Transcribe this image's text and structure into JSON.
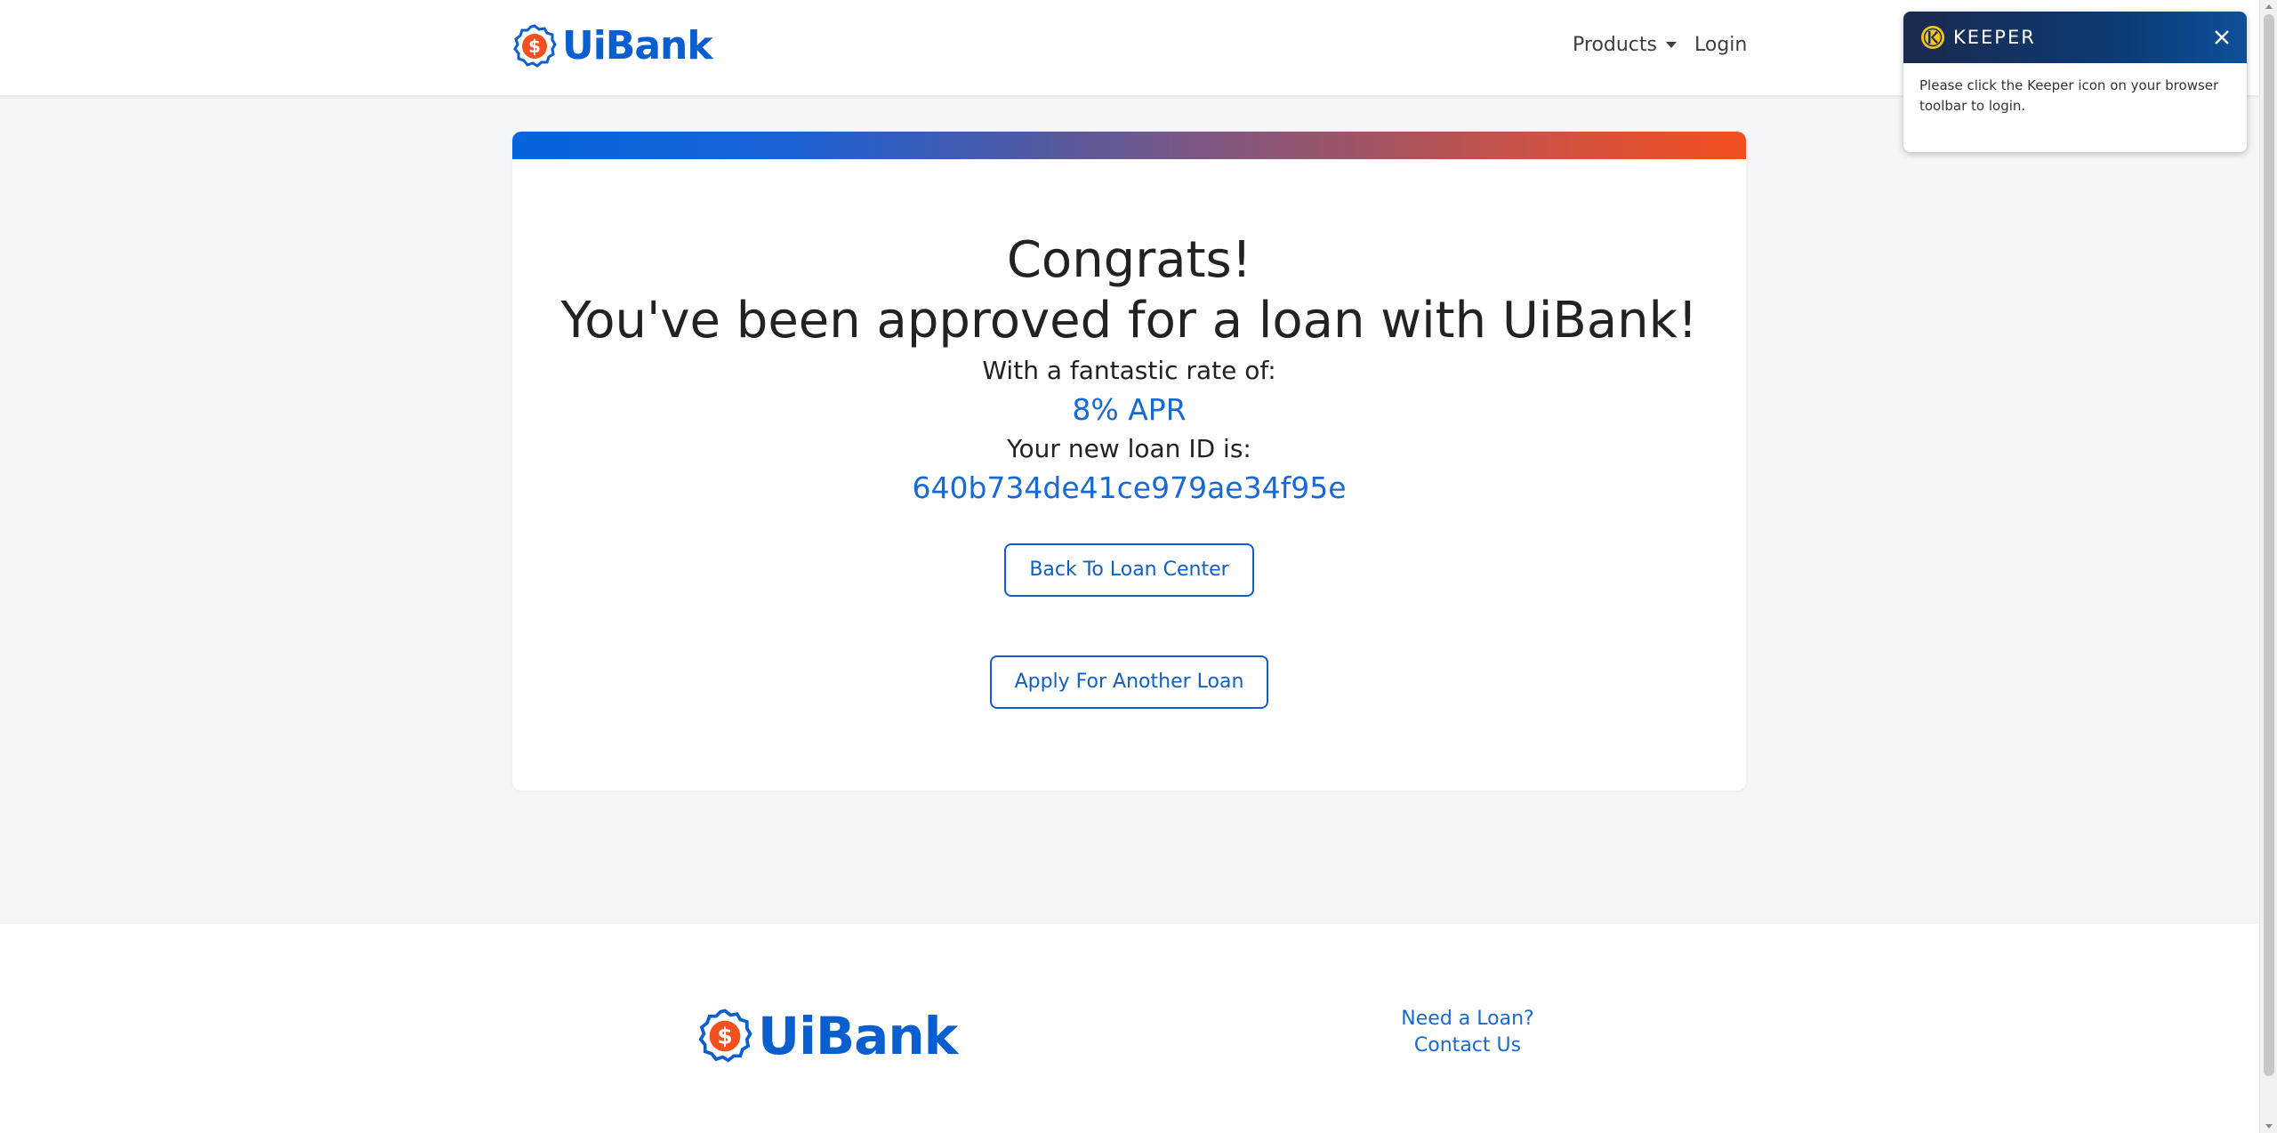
{
  "header": {
    "logo_text": "UiBank",
    "nav": {
      "products_label": "Products",
      "login_label": "Login"
    }
  },
  "card": {
    "congrats": "Congrats!",
    "approved": "You've been approved for a loan with UiBank!",
    "rate_label": "With a fantastic rate of:",
    "rate_value": "8% APR",
    "id_label": "Your new loan ID is:",
    "id_value": "640b734de41ce979ae34f95e",
    "back_button": "Back To Loan Center",
    "apply_button": "Apply For Another Loan"
  },
  "footer": {
    "logo_text": "UiBank",
    "links": {
      "need_loan": "Need a Loan?",
      "contact": "Contact Us"
    }
  },
  "keeper": {
    "title": "KEEPER",
    "message": "Please click the Keeper icon on your browser toolbar to login."
  },
  "colors": {
    "brand_blue": "#0a5fd0",
    "brand_orange": "#f34f1f",
    "accent_blue": "#1769d6"
  },
  "icons": {
    "logo": "dollar-badge-icon",
    "caret": "caret-down-icon",
    "keeper_logo": "keeper-logo-icon",
    "close": "close-icon"
  }
}
